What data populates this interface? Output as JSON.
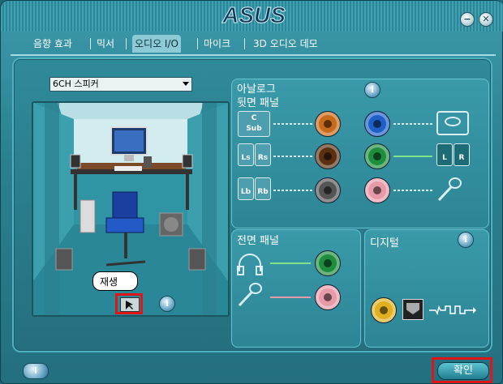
{
  "title_bar": {
    "brand": "ASUS",
    "minimize_glyph": "−",
    "close_glyph": "✕"
  },
  "tabs": [
    {
      "label": "음향 효과"
    },
    {
      "label": "믹서"
    },
    {
      "label": "오디오 I/O"
    },
    {
      "label": "마이크"
    },
    {
      "label": "3D 오디오 데모"
    }
  ],
  "active_tab": "오디오 I/O",
  "speaker_config": {
    "selected": "6CH 스피커"
  },
  "tooltip": {
    "text": "재생"
  },
  "analog": {
    "title": "아날로그",
    "rear_panel_label": "뒷면 패널",
    "channels": [
      {
        "id": "c-sub",
        "lines": [
          "C",
          "Sub"
        ],
        "color": "#c86a1a"
      },
      {
        "id": "ls-rs",
        "lines": [
          "Ls",
          "Rs"
        ],
        "color": "#5a3010"
      },
      {
        "id": "lb-rb",
        "lines": [
          "Lb",
          "Rb"
        ],
        "color": "#555555"
      }
    ],
    "right_jacks": [
      {
        "id": "line-in",
        "color": "#1e5fc8"
      },
      {
        "id": "front-out",
        "color": "#1e8e3e"
      },
      {
        "id": "mic-in",
        "color": "#e89aa8"
      }
    ],
    "front_lr": [
      "L",
      "R"
    ]
  },
  "front_panel": {
    "title": "전면 패널",
    "jacks": [
      {
        "id": "headphone",
        "color": "#1e8e3e"
      },
      {
        "id": "mic",
        "color": "#e89aa8"
      }
    ]
  },
  "digital": {
    "title": "디지털",
    "coax_color": "#e0b020"
  },
  "buttons": {
    "ok_label": "확인",
    "help_glyph": "i",
    "info_glyph": "i"
  },
  "colors": {
    "accent": "#2a8191",
    "highlight": "#e01515"
  }
}
